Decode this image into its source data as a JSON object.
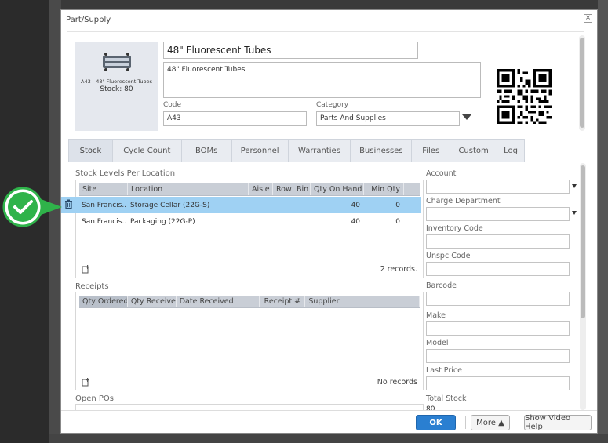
{
  "dialog": {
    "title": "Part/Supply",
    "close_glyph": "×"
  },
  "part": {
    "photo_caption": "A43 - 48\" Fluorescent Tubes",
    "photo_stock": "Stock: 80",
    "name": "48\" Fluorescent Tubes",
    "description": "48\" Fluorescent Tubes",
    "code_label": "Code",
    "code_value": "A43",
    "category_label": "Category",
    "category_value": "Parts And Supplies"
  },
  "tabs": [
    {
      "label": "Stock",
      "active": true
    },
    {
      "label": "Cycle Count",
      "active": false
    },
    {
      "label": "BOMs",
      "active": false
    },
    {
      "label": "Personnel",
      "active": false
    },
    {
      "label": "Warranties",
      "active": false
    },
    {
      "label": "Businesses",
      "active": false
    },
    {
      "label": "Files",
      "active": false
    },
    {
      "label": "Custom",
      "active": false
    },
    {
      "label": "Log",
      "active": false
    }
  ],
  "stock_levels": {
    "title": "Stock Levels Per Location",
    "columns": [
      "Site",
      "Location",
      "Aisle",
      "Row",
      "Bin",
      "Qty On Hand",
      "Min Qty"
    ],
    "rows": [
      {
        "site": "San Francis...",
        "location": "Storage Cellar (22G-S)",
        "aisle": "",
        "row": "",
        "bin": "",
        "qty_on_hand": "40",
        "min_qty": "0"
      },
      {
        "site": "San Francis...",
        "location": "Packaging (22G-P)",
        "aisle": "",
        "row": "",
        "bin": "",
        "qty_on_hand": "40",
        "min_qty": "0"
      }
    ],
    "footer": "2 records."
  },
  "receipts": {
    "title": "Receipts",
    "columns": [
      "Qty Ordered",
      "Qty Received",
      "Date Received",
      "Receipt #",
      "Supplier"
    ],
    "footer": "No records"
  },
  "open_pos": {
    "title": "Open POs"
  },
  "right_fields": {
    "account": "Account",
    "charge_department": "Charge Department",
    "inventory_code": "Inventory Code",
    "unspc_code": "Unspc Code",
    "barcode": "Barcode",
    "make": "Make",
    "model": "Model",
    "last_price": "Last Price",
    "total_stock": "Total Stock",
    "total_stock_value": "80"
  },
  "buttons": {
    "ok": "OK",
    "more": "More ▲",
    "video_help": "Show Video Help"
  },
  "colors": {
    "accent": "#2a7fd1",
    "selected_row": "#9fd1f3",
    "check_green": "#2fb34a"
  }
}
